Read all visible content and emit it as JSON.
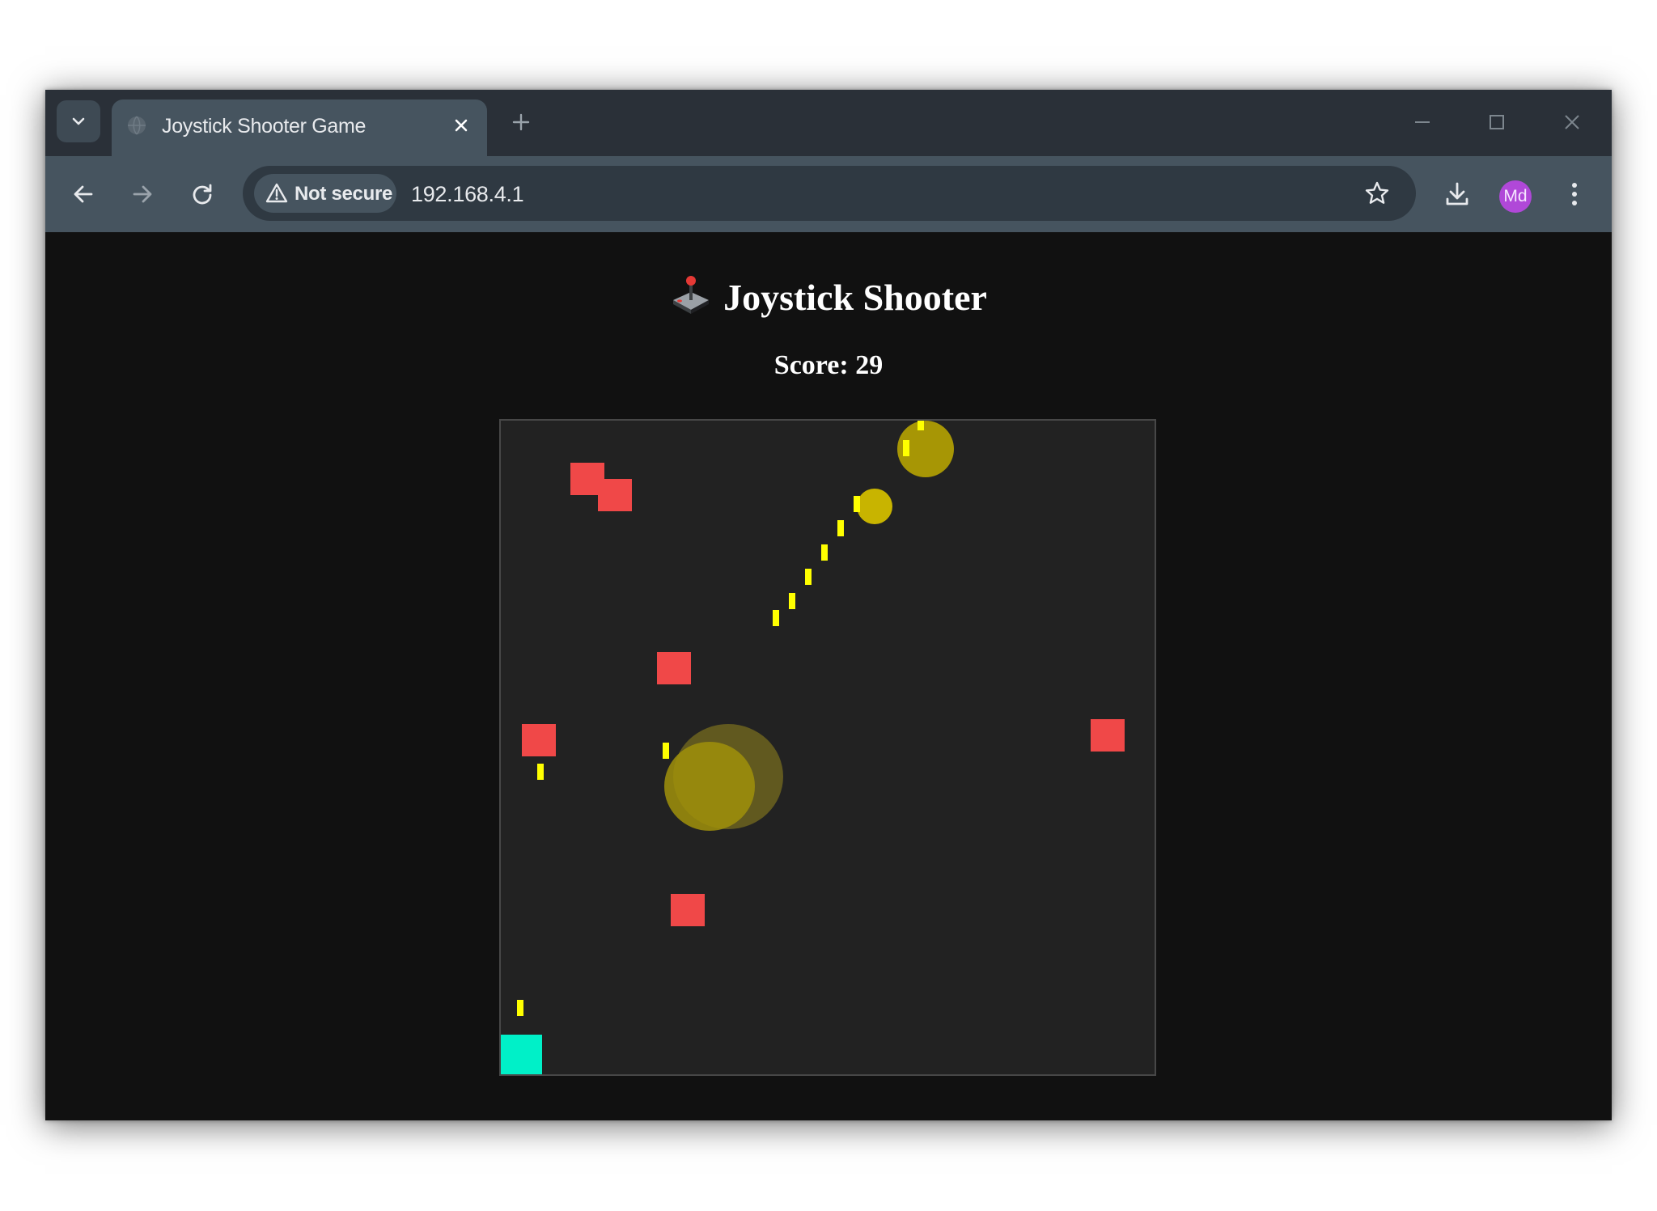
{
  "browser": {
    "tab_title": "Joystick Shooter Game",
    "security_label": "Not secure",
    "url": "192.168.4.1",
    "profile_initials": "Md"
  },
  "page": {
    "title": "Joystick Shooter",
    "title_emoji": "joystick-icon",
    "score_label": "Score:",
    "score": 29
  },
  "colors": {
    "page_background": "#111111",
    "canvas_background": "#222222",
    "enemy": "#f04848",
    "bullet": "#ffff00",
    "player": "#00f0c8",
    "orb": "#c8b400"
  }
}
